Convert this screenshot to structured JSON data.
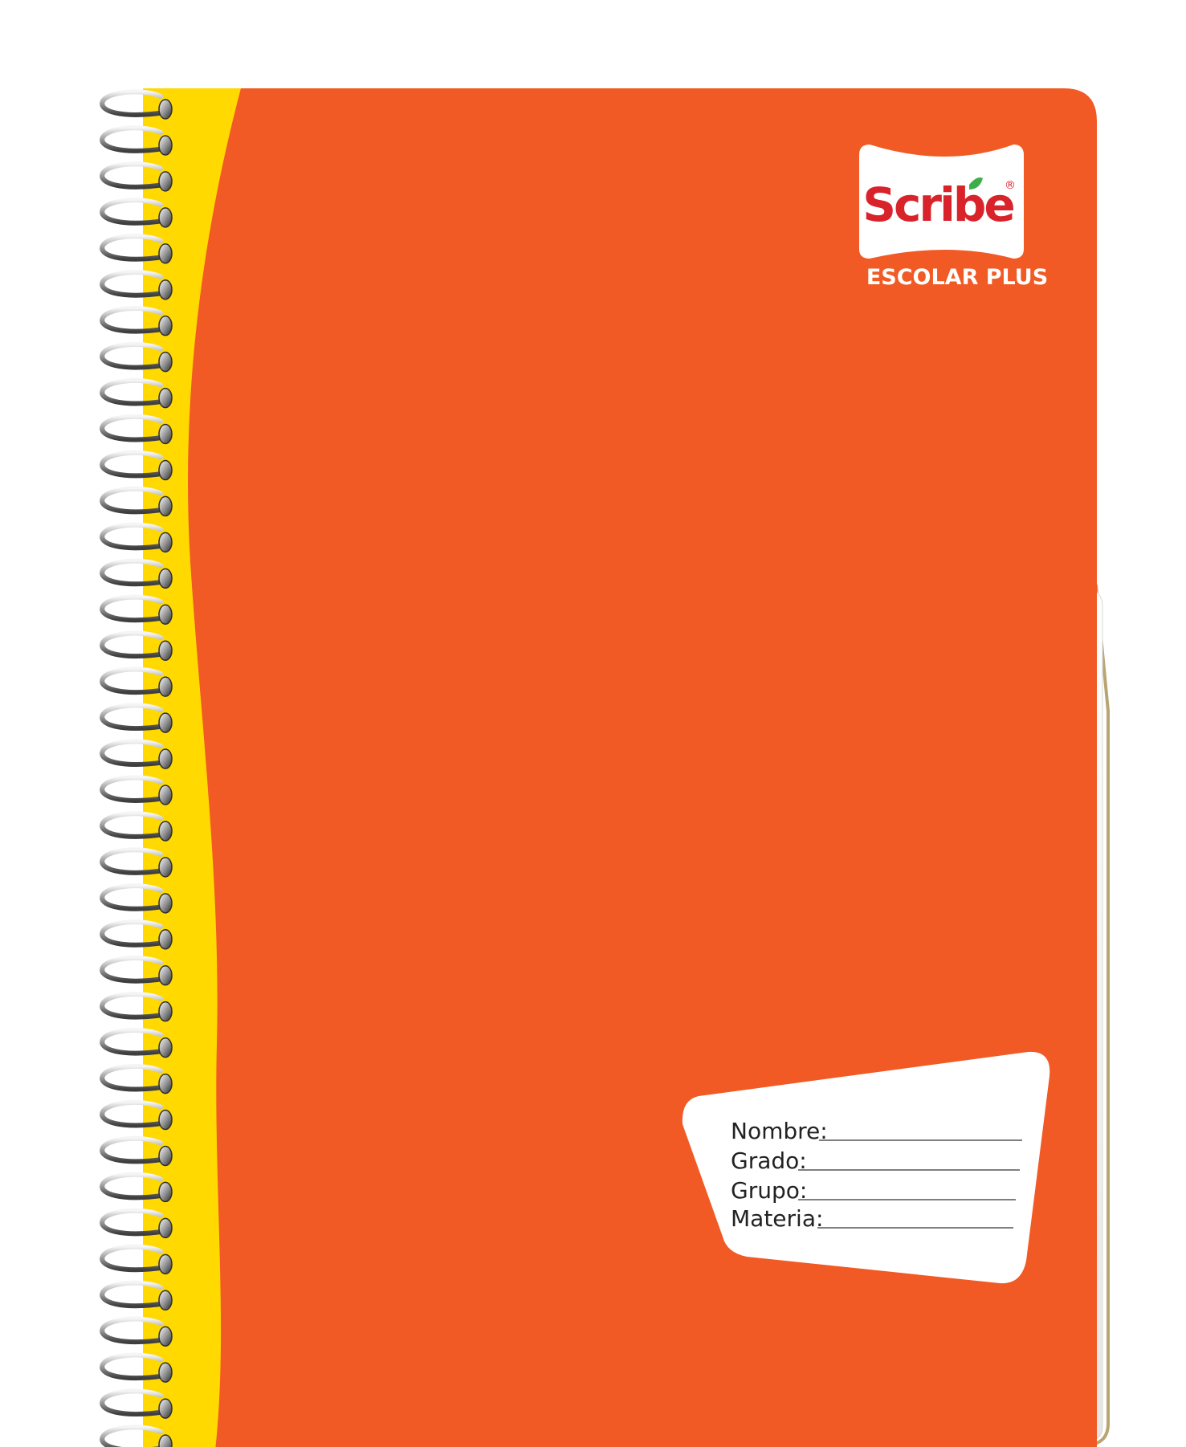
{
  "brand": {
    "name": "Scribe",
    "registered_mark": "®",
    "product_line": "ESCOLAR PLUS"
  },
  "label": {
    "fields": [
      "Nombre:",
      "Grado:",
      "Grupo:",
      "Materia:"
    ]
  },
  "colors": {
    "cover": "#F15A24",
    "spine": "#FFD900",
    "brand_red": "#D8232A",
    "paper": "#F4F4F4",
    "page_edge": "#B9A572",
    "coil": "#8C8C8C"
  }
}
